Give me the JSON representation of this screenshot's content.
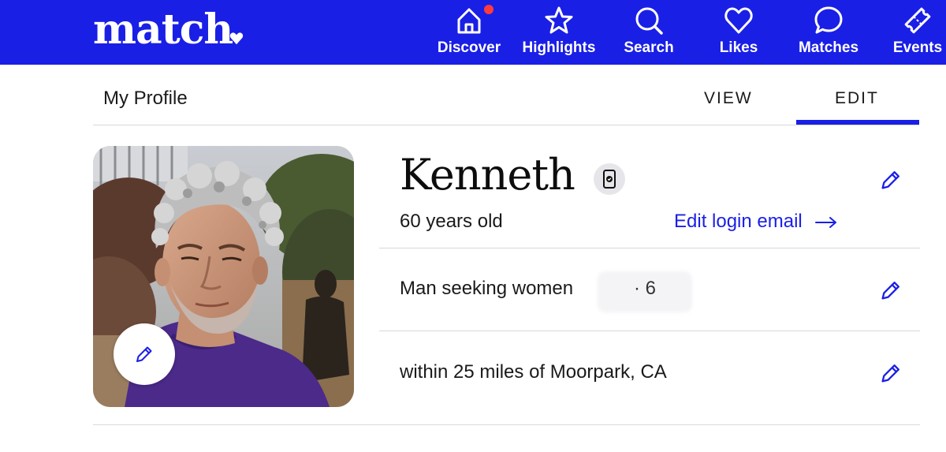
{
  "brand": {
    "logo_text": "match",
    "color": "#1a1fe6",
    "notification_color": "#ff3b3b"
  },
  "nav": {
    "items": [
      {
        "label": "Discover",
        "icon": "home-icon",
        "has_notification": true
      },
      {
        "label": "Highlights",
        "icon": "star-icon"
      },
      {
        "label": "Search",
        "icon": "search-icon"
      },
      {
        "label": "Likes",
        "icon": "heart-icon"
      },
      {
        "label": "Matches",
        "icon": "chat-bubble-icon"
      },
      {
        "label": "Events",
        "icon": "ticket-icon"
      }
    ]
  },
  "header": {
    "title": "My Profile",
    "tabs": [
      {
        "label": "VIEW",
        "active": false
      },
      {
        "label": "EDIT",
        "active": true
      }
    ]
  },
  "profile": {
    "name": "Kenneth",
    "verified_icon": "phone-verified-icon",
    "age": "60 years old",
    "edit_email_label": "Edit login email",
    "seeking": "Man seeking women",
    "age_range_partial": "· 6",
    "location": "within 25 miles of Moorpark, CA"
  }
}
